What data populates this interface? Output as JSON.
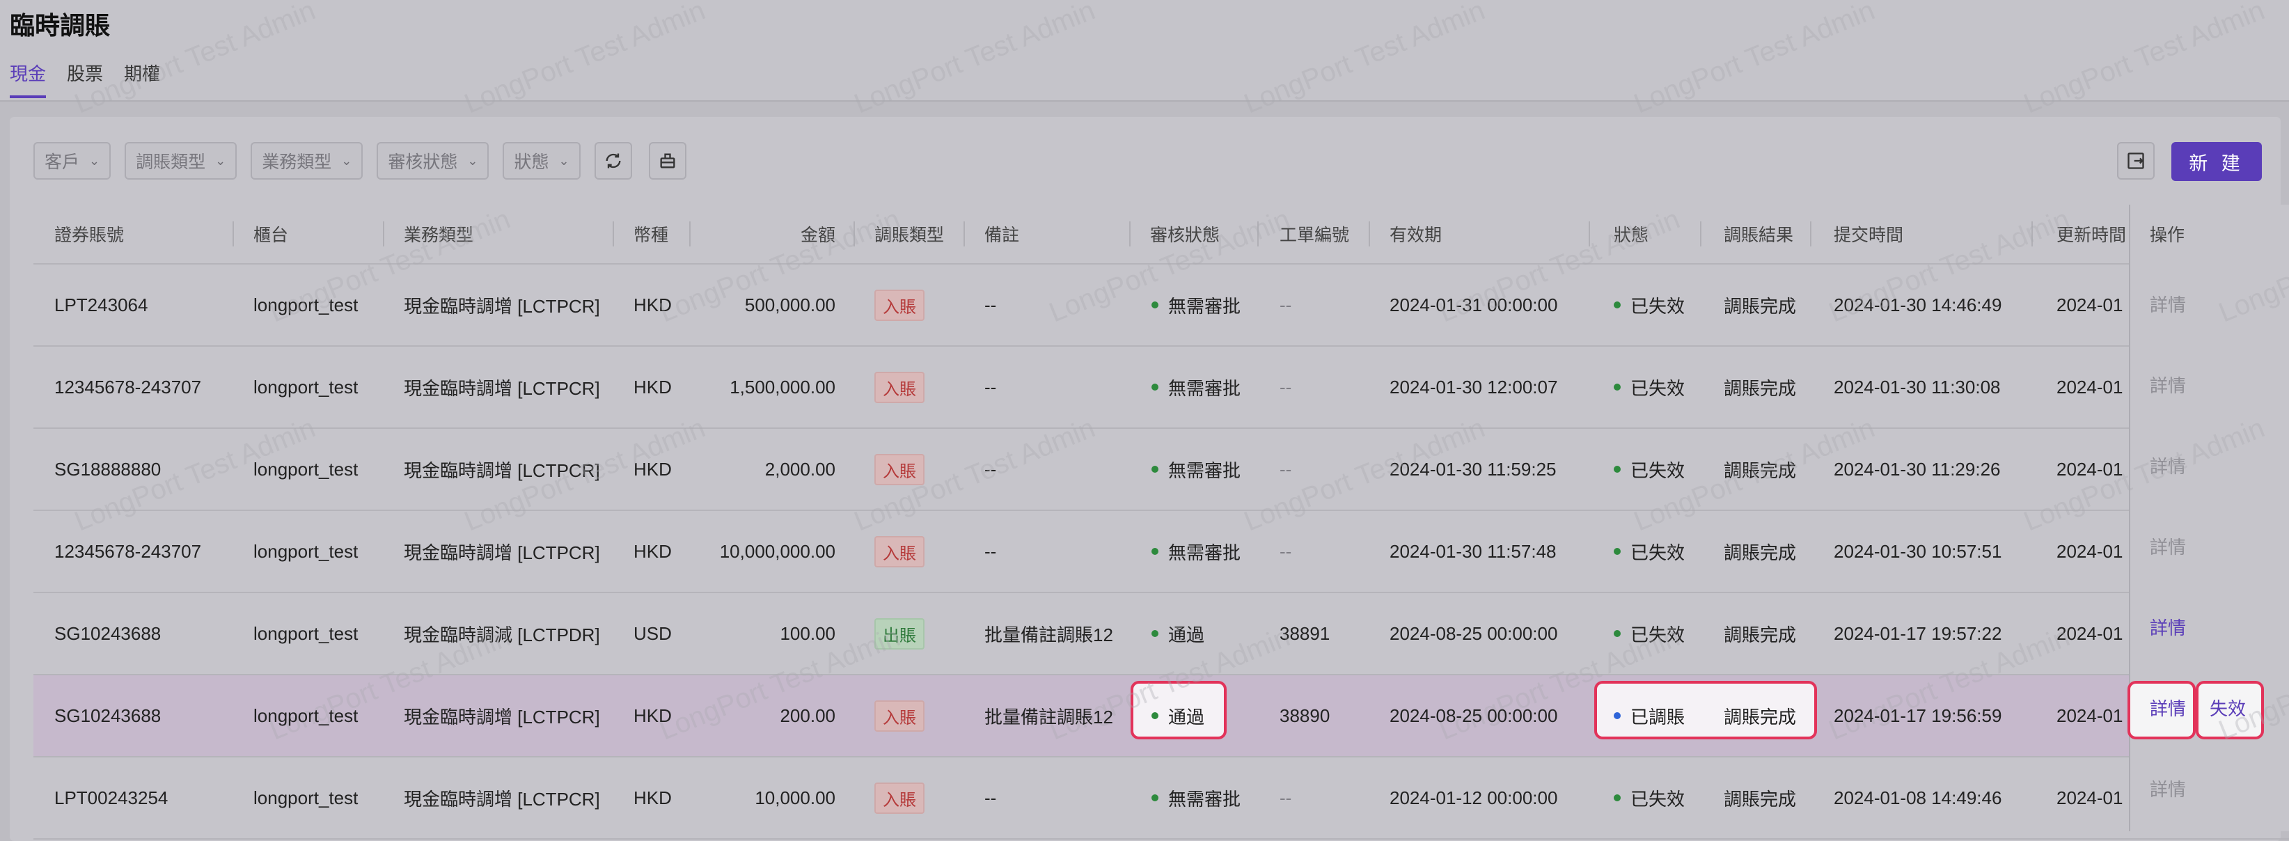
{
  "page": {
    "title": "臨時調賬",
    "watermark": "LongPort Test Admin"
  },
  "tabs": [
    {
      "label": "現金",
      "active": true
    },
    {
      "label": "股票"
    },
    {
      "label": "期權"
    }
  ],
  "filters": [
    "客戶",
    "調賬類型",
    "業務類型",
    "審核狀態",
    "狀態"
  ],
  "toolbar": {
    "new_label": "新 建"
  },
  "columns": [
    "證券賬號",
    "櫃台",
    "業務類型",
    "幣種",
    "金額",
    "調賬類型",
    "備註",
    "審核狀態",
    "工單編號",
    "有效期",
    "狀態",
    "調賬結果",
    "提交時間",
    "更新時間",
    "操作"
  ],
  "rows": [
    {
      "account": "LPT243064",
      "counter": "longport_test",
      "biz": "現金臨時調增 [LCTPCR]",
      "ccy": "HKD",
      "amount": "500,000.00",
      "type": "入賬",
      "note": "--",
      "audit": "無需審批",
      "ticket": "--",
      "valid": "2024-01-31 00:00:00",
      "status": "已失效",
      "result": "調賬完成",
      "submitted": "2024-01-30 14:46:49",
      "updated": "2024-01",
      "op1": "詳情"
    },
    {
      "account": "12345678-243707",
      "counter": "longport_test",
      "biz": "現金臨時調增 [LCTPCR]",
      "ccy": "HKD",
      "amount": "1,500,000.00",
      "type": "入賬",
      "note": "--",
      "audit": "無需審批",
      "ticket": "--",
      "valid": "2024-01-30 12:00:07",
      "status": "已失效",
      "result": "調賬完成",
      "submitted": "2024-01-30 11:30:08",
      "updated": "2024-01",
      "op1": "詳情"
    },
    {
      "account": "SG18888880",
      "counter": "longport_test",
      "biz": "現金臨時調增 [LCTPCR]",
      "ccy": "HKD",
      "amount": "2,000.00",
      "type": "入賬",
      "note": "--",
      "audit": "無需審批",
      "ticket": "--",
      "valid": "2024-01-30 11:59:25",
      "status": "已失效",
      "result": "調賬完成",
      "submitted": "2024-01-30 11:29:26",
      "updated": "2024-01",
      "op1": "詳情"
    },
    {
      "account": "12345678-243707",
      "counter": "longport_test",
      "biz": "現金臨時調增 [LCTPCR]",
      "ccy": "HKD",
      "amount": "10,000,000.00",
      "type": "入賬",
      "note": "--",
      "audit": "無需審批",
      "ticket": "--",
      "valid": "2024-01-30 11:57:48",
      "status": "已失效",
      "result": "調賬完成",
      "submitted": "2024-01-30 10:57:51",
      "updated": "2024-01",
      "op1": "詳情"
    },
    {
      "account": "SG10243688",
      "counter": "longport_test",
      "biz": "現金臨時調減 [LCTPDR]",
      "ccy": "USD",
      "amount": "100.00",
      "type": "出賬",
      "note": "批量備註調賬12",
      "audit": "通過",
      "ticket": "38891",
      "valid": "2024-08-25 00:00:00",
      "status": "已失效",
      "result": "調賬完成",
      "submitted": "2024-01-17 19:57:22",
      "updated": "2024-01",
      "op1": "詳情"
    },
    {
      "account": "SG10243688",
      "counter": "longport_test",
      "biz": "現金臨時調增 [LCTPCR]",
      "ccy": "HKD",
      "amount": "200.00",
      "type": "入賬",
      "note": "批量備註調賬12",
      "audit": "通過",
      "ticket": "38890",
      "valid": "2024-08-25 00:00:00",
      "status": "已調賬",
      "result": "調賬完成",
      "submitted": "2024-01-17 19:56:59",
      "updated": "2024-01",
      "op1": "詳情",
      "op2": "失效"
    },
    {
      "account": "LPT00243254",
      "counter": "longport_test",
      "biz": "現金臨時調增 [LCTPCR]",
      "ccy": "HKD",
      "amount": "10,000.00",
      "type": "入賬",
      "note": "--",
      "audit": "無需審批",
      "ticket": "--",
      "valid": "2024-01-12 00:00:00",
      "status": "已失效",
      "result": "調賬完成",
      "submitted": "2024-01-08 14:49:46",
      "updated": "2024-01",
      "op1": "詳情"
    }
  ]
}
